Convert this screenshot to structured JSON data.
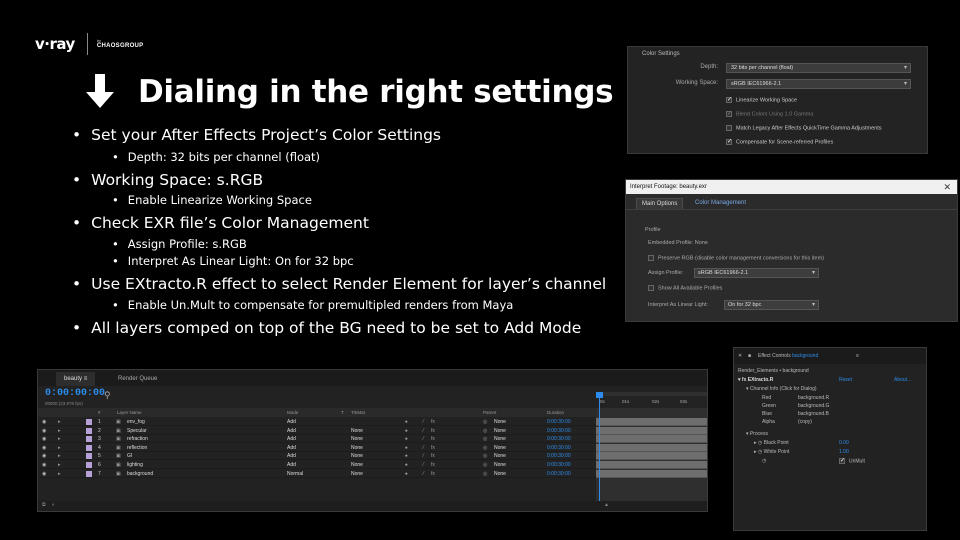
{
  "logo": {
    "brand": "v·ray",
    "by": "by",
    "company": "CHAOSGROUP"
  },
  "slide": {
    "title": "Dialing in the right settings",
    "bullets": [
      {
        "text": "Set your After Effects Project’s Color Settings",
        "sub": [
          "Depth: 32 bits per channel (float)"
        ]
      },
      {
        "text": "Working Space: s.RGB",
        "sub": [
          "Enable Linearize Working Space"
        ]
      },
      {
        "text": "Check EXR file’s Color Management",
        "sub": [
          "Assign Profile: s.RGB",
          "Interpret As Linear Light: On for 32 bpc"
        ]
      },
      {
        "text": "Use EXtracto.R effect to select Render Element for layer’s channel",
        "sub": [
          "Enable Un.Mult to compensate for premultipled renders from Maya"
        ]
      },
      {
        "text": "All layers comped on top of the BG need to be set to Add Mode",
        "sub": []
      }
    ]
  },
  "color_settings": {
    "title": "Color Settings",
    "depth_label": "Depth:",
    "depth_value": "32 bits per channel (float)",
    "working_space_label": "Working Space:",
    "working_space_value": "sRGB IEC61966-2.1",
    "options": [
      {
        "label": "Linearize Working Space",
        "checked": true,
        "enabled": true
      },
      {
        "label": "Blend Colors Using 1.0 Gamma",
        "checked": true,
        "enabled": false
      },
      {
        "label": "Match Legacy After Effects QuickTime Gamma Adjustments",
        "checked": false,
        "enabled": true
      },
      {
        "label": "Compensate for Scene-referred Profiles",
        "checked": true,
        "enabled": true
      }
    ]
  },
  "interpret_footage": {
    "title": "Interpret Footage: beauty.exr",
    "close": "✕",
    "tabs": [
      "Main Options",
      "Color Management"
    ],
    "section": "Profile",
    "embedded_profile": "Embedded Profile:  None",
    "preserve_rgb": "Preserve RGB (disable color management conversions for this item)",
    "assign_profile_label": "Assign Profile:",
    "assign_profile_value": "sRGB IEC61966-2.1",
    "show_all": "Show All Available Profiles",
    "interpret_linear_label": "Interpret As Linear Light:",
    "interpret_linear_value": "On for 32 bpc"
  },
  "timeline": {
    "tabs": [
      "beauty",
      "Render Queue"
    ],
    "timecode": "0:00:00:00",
    "fps": "00000 (23.976 fps)",
    "headers": {
      "num": "#",
      "name": "Layer Name",
      "mode": "Mode",
      "t": "T",
      "trkmat": "TrkMat",
      "parent": "Parent",
      "duration": "Duration"
    },
    "ruler": [
      "0s",
      "01s",
      "02s",
      "03s"
    ],
    "layers": [
      {
        "num": "1",
        "name": "env_fog",
        "mode": "Add",
        "trkmat": "",
        "parent": "None",
        "duration": "0:00:30:00",
        "color": "#b5a0d8"
      },
      {
        "num": "2",
        "name": "Specular",
        "mode": "Add",
        "trkmat": "None",
        "parent": "None",
        "duration": "0:00:30:00",
        "color": "#b5a0d8"
      },
      {
        "num": "3",
        "name": "refraction",
        "mode": "Add",
        "trkmat": "None",
        "parent": "None",
        "duration": "0:00:30:00",
        "color": "#b5a0d8"
      },
      {
        "num": "4",
        "name": "reflection",
        "mode": "Add",
        "trkmat": "None",
        "parent": "None",
        "duration": "0:00:30:00",
        "color": "#b5a0d8"
      },
      {
        "num": "5",
        "name": "GI",
        "mode": "Add",
        "trkmat": "None",
        "parent": "None",
        "duration": "0:00:30:00",
        "color": "#b5a0d8"
      },
      {
        "num": "6",
        "name": "lighting",
        "mode": "Add",
        "trkmat": "None",
        "parent": "None",
        "duration": "0:00:30:00",
        "color": "#b5a0d8"
      },
      {
        "num": "7",
        "name": "background",
        "mode": "Normal",
        "trkmat": "None",
        "parent": "None",
        "duration": "0:00:30:00",
        "color": "#b5a0d8"
      }
    ]
  },
  "effect_controls": {
    "title": "Effect Controls",
    "layer": "background",
    "comp_path": "Render_Elements • background",
    "effect_name": "EXtracto.R",
    "reset": "Reset",
    "about": "About...",
    "channel_info": "Channel Info (Click for Dialog)",
    "channels": [
      {
        "label": "Red",
        "value": "background.R"
      },
      {
        "label": "Green",
        "value": "background.G"
      },
      {
        "label": "Blue",
        "value": "background.B"
      },
      {
        "label": "Alpha",
        "value": "(copy)"
      }
    ],
    "process": "Process",
    "black_point_label": "Black Point",
    "black_point_value": "0.00",
    "white_point_label": "White Point",
    "white_point_value": "1.00",
    "unmult": "UnMult"
  }
}
